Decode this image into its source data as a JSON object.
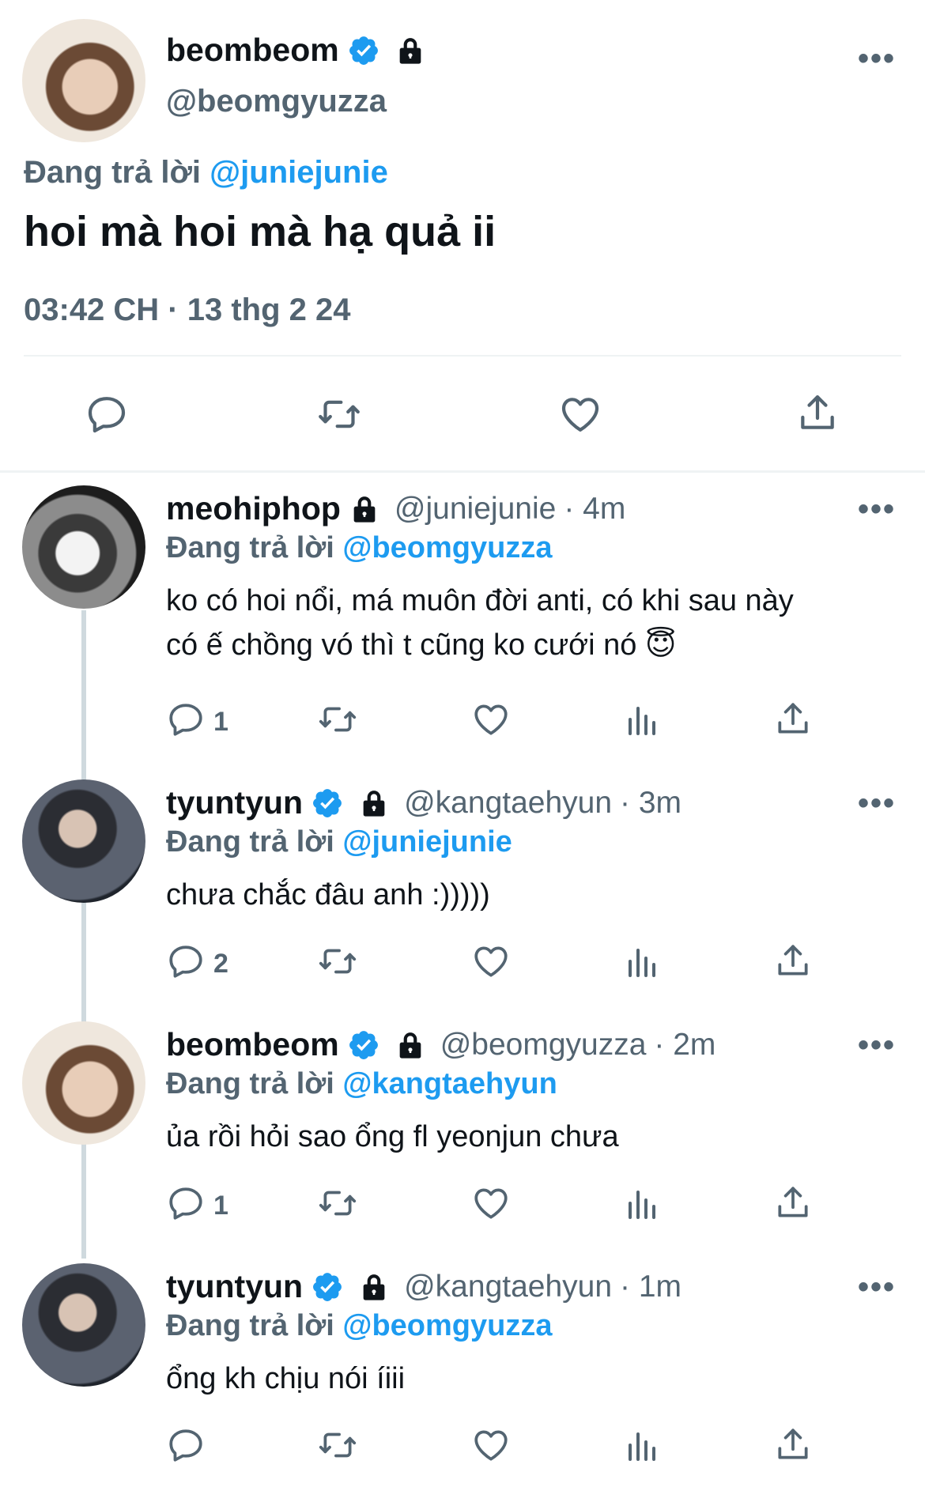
{
  "main_tweet": {
    "display_name": "beombeom",
    "handle": "@beomgyuzza",
    "replying_prefix": "Đang trả lời",
    "replying_to": "@juniejunie",
    "text": "hoi mà hoi mà hạ quả ii",
    "timestamp": "03:42 CH · 13 thg 2 24",
    "more": "•••"
  },
  "replies": [
    {
      "display_name": "meohiphop",
      "handle": "@juniejunie",
      "time": "· 4m",
      "replying_prefix": "Đang trả lời",
      "replying_to": "@beomgyuzza",
      "text_line1": "ko có hoi nổi, má muôn đời anti, có khi sau này",
      "text_line2": "có ế chồng vó thì t cũng ko cưới nó 😇",
      "reply_count": "1",
      "more": "•••"
    },
    {
      "display_name": "tyuntyun",
      "handle": "@kangtaehyun",
      "time": "· 3m",
      "replying_prefix": "Đang trả lời",
      "replying_to": "@juniejunie",
      "text_line1": "chưa chắc đâu anh :)))))",
      "reply_count": "2",
      "more": "•••"
    },
    {
      "display_name": "beombeom",
      "handle": "@beomgyuzza",
      "time": "· 2m",
      "replying_prefix": "Đang trả lời",
      "replying_to": "@kangtaehyun",
      "text_line1": "ủa rồi hỏi sao ổng fl yeonjun chưa",
      "reply_count": "1",
      "more": "•••"
    },
    {
      "display_name": "tyuntyun",
      "handle": "@kangtaehyun",
      "time": "· 1m",
      "replying_prefix": "Đang trả lời",
      "replying_to": "@beomgyuzza",
      "text_line1": "ổng kh chịu nói íiii",
      "reply_count": "",
      "more": "•••"
    }
  ],
  "colors": {
    "accent": "#1d9bf0",
    "secondary_text": "#536471",
    "divider": "#eff3f4",
    "thread_line": "#cfd9de"
  },
  "icons": [
    "verified-badge-icon",
    "lock-icon",
    "reply-icon",
    "retweet-icon",
    "like-icon",
    "views-icon",
    "share-icon",
    "more-icon"
  ]
}
